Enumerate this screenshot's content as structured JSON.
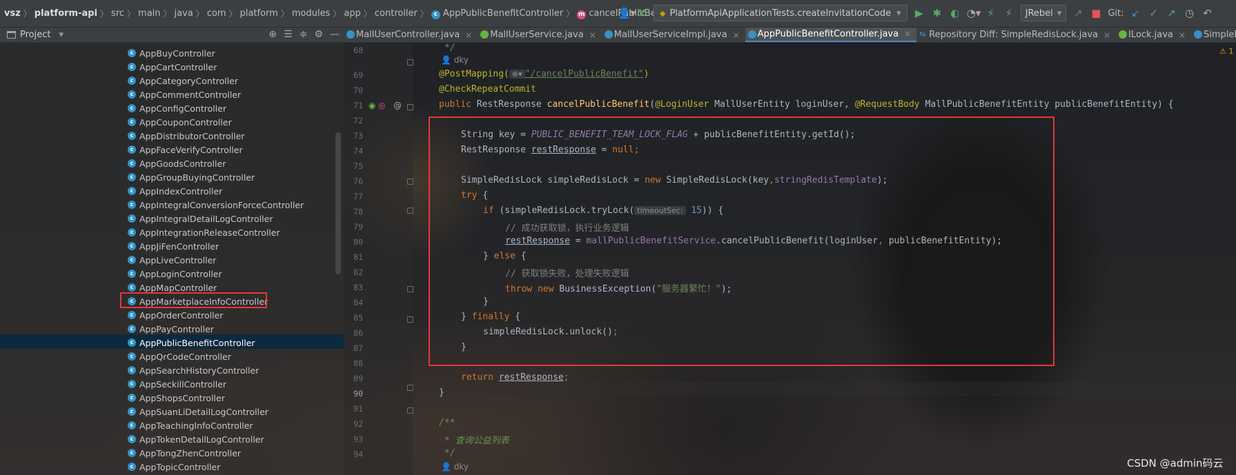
{
  "navbar": {
    "crumbs": [
      "vsz",
      "platform-api",
      "src",
      "main",
      "java",
      "com",
      "platform",
      "modules",
      "app",
      "controller"
    ],
    "class_crumb": "AppPublicBenefitController",
    "method_crumb": "cancelPublicBenefit",
    "run_config": "PlatformApiApplicationTests.createInvitationCode",
    "jrebel": "JRebel",
    "git_label": "Git:"
  },
  "project_panel": {
    "title": "Project"
  },
  "tabs": [
    {
      "label": "MallUserController.java"
    },
    {
      "label": "MallUserService.java"
    },
    {
      "label": "MallUserServiceImpl.java"
    },
    {
      "label": "AppPublicBenefitController.java"
    },
    {
      "label": "Repository Diff: SimpleRedisLock.java"
    },
    {
      "label": "ILock.java"
    },
    {
      "label": "SimpleRedisLock.java"
    }
  ],
  "tree": {
    "items": [
      "AppBuyController",
      "AppCartController",
      "AppCategoryController",
      "AppCommentController",
      "AppConfigController",
      "AppCouponController",
      "AppDistributorController",
      "AppFaceVerifyController",
      "AppGoodsController",
      "AppGroupBuyingController",
      "AppIndexController",
      "AppIntegralConversionForceController",
      "AppIntegralDetailLogController",
      "AppIntegrationReleaseController",
      "AppJiFenController",
      "AppLiveController",
      "AppLoginController",
      "AppMapController",
      "AppMarketplaceInfoController",
      "AppOrderController",
      "AppPayController",
      "AppPublicBenefitController",
      "AppQrCodeController",
      "AppSearchHistoryController",
      "AppSeckillController",
      "AppShopsController",
      "AppSuanLiDetailLogController",
      "AppTeachingInfoController",
      "AppTokenDetailLogController",
      "AppTongZhenController",
      "AppTopicController"
    ],
    "selected": "AppPublicBenefitController"
  },
  "editor": {
    "line_numbers": [
      "68",
      "69",
      "70",
      "71",
      "72",
      "73",
      "74",
      "75",
      "76",
      "77",
      "78",
      "79",
      "80",
      "81",
      "82",
      "83",
      "84",
      "85",
      "86",
      "87",
      "88",
      "89",
      "90",
      "91",
      "92",
      "93",
      "94"
    ],
    "author": "dky",
    "doc_end": "*/",
    "mapping_annotation": "@PostMapping(",
    "mapping_path": "\"/cancelPublicBenefit\"",
    "check_annotation": "@CheckRepeatCommit",
    "method_signature": {
      "public": "public",
      "ret_type": "RestResponse",
      "name": "cancelPublicBenefit",
      "ann1": "@LoginUser",
      "param1": "MallUserEntity loginUser,",
      "ann2": "@RequestBody",
      "param2": "MallPublicBenefitEntity publicBenefitEntity) {"
    },
    "l73": {
      "type": "String key = ",
      "const": "PUBLIC_BENEFIT_TEAM_LOCK_FLAG",
      "rest": " + publicBenefitEntity.getId();"
    },
    "l74": {
      "type": "RestResponse ",
      "var": "restResponse",
      "eq": " = ",
      "null": "null",
      "semi": ";"
    },
    "l76": {
      "a": "SimpleRedisLock simpleRedisLock = ",
      "new": "new",
      "b": " SimpleRedisLock(key",
      "comma": ",",
      "field": "stringRedisTemplate",
      "c": ");"
    },
    "l77": {
      "try": "try",
      "brace": " {"
    },
    "l78": {
      "if": "if",
      "a": " (simpleRedisLock.tryLock(",
      "hint": "timeoutSec:",
      "num": "15",
      "b": ")) {"
    },
    "l79": "// 成功获取锁，执行业务逻辑",
    "l80": {
      "var": "restResponse",
      "eq": " = ",
      "svc": "mallPublicBenefitService",
      "rest": ".cancelPublicBenefit(loginUser",
      "comma": ",",
      "rest2": " publicBenefitEntity);"
    },
    "l81": {
      "a": "} ",
      "else": "else",
      "b": " {"
    },
    "l82": "// 获取锁失败，处理失败逻辑",
    "l83": {
      "throw": "throw",
      "new": "new",
      "a": " BusinessException(",
      "str": "\"服务器繁忙！\"",
      "b": ");"
    },
    "l84": "}",
    "l85": {
      "a": "} ",
      "finally": "finally",
      "b": " {"
    },
    "l86": {
      "a": "simpleRedisLock.unlock()",
      "semi": ";"
    },
    "l87": "}",
    "l89": {
      "return": "return",
      "var": "restResponse",
      "semi": ";"
    },
    "l90": "}",
    "l92": "/**",
    "l93": "* 查询公益列表",
    "l94": "*/",
    "author2": "dky"
  },
  "warning_count": "1",
  "watermark": "CSDN @admin码云"
}
